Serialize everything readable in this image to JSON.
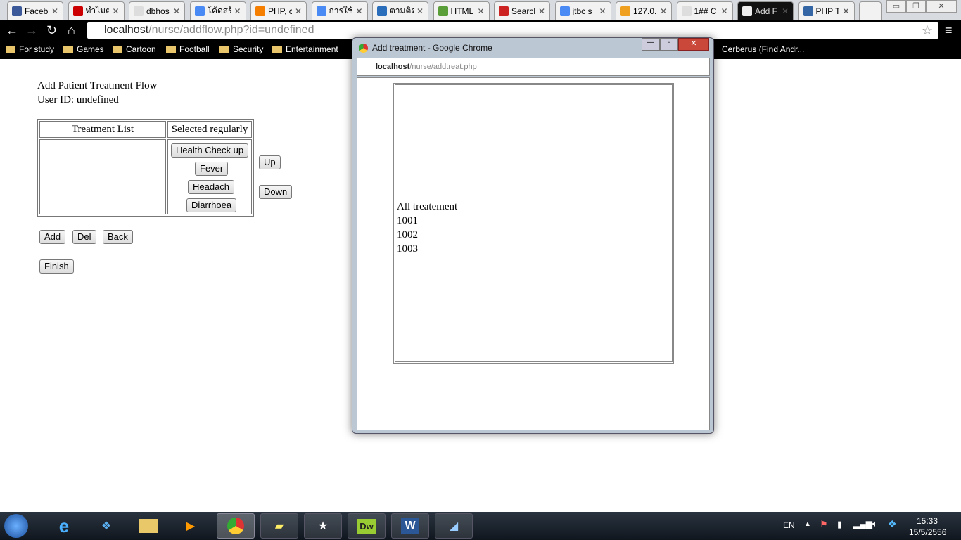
{
  "browser": {
    "tabs": [
      {
        "label": "Faceb",
        "color": "#3b5998"
      },
      {
        "label": "ทำไมต่",
        "color": "#c00"
      },
      {
        "label": "dbhos",
        "color": "#ddd"
      },
      {
        "label": "โค้ดสร้",
        "color": "#4a8af4"
      },
      {
        "label": "PHP, c",
        "color": "#f57d00"
      },
      {
        "label": "การใช้",
        "color": "#4a8af4"
      },
      {
        "label": "ตามติด",
        "color": "#2a6ebb"
      },
      {
        "label": "HTML",
        "color": "#5a9e3a"
      },
      {
        "label": "Search",
        "color": "#c22"
      },
      {
        "label": "jtbc s",
        "color": "#4a8af4"
      },
      {
        "label": "127.0.",
        "color": "#f0a020"
      },
      {
        "label": "1## C",
        "color": "#ddd"
      },
      {
        "label": "Add F",
        "color": "#eee"
      },
      {
        "label": "PHP T",
        "color": "#3465a4"
      }
    ],
    "url_host": "localhost",
    "url_path": "/nurse/addflow.php?id=undefined",
    "bookmarks": [
      "For study",
      "Games",
      "Cartoon",
      "Football",
      "Security",
      "Entertainment"
    ],
    "bookmark_extra": "Cerberus (Find Andr..."
  },
  "page": {
    "heading": "Add Patient Treatment Flow",
    "user_line": "User ID: undefined",
    "col1": "Treatment List",
    "col2": "Selected regularly",
    "selected": [
      "Health Check up",
      "Fever",
      "Headach",
      "Diarrhoea"
    ],
    "up": "Up",
    "down": "Down",
    "add": "Add",
    "del": "Del",
    "back": "Back",
    "finish": "Finish"
  },
  "popup": {
    "title": "Add treatment - Google Chrome",
    "url_host": "localhost",
    "url_path": "/nurse/addtreat.php",
    "list_title": "All treatement",
    "items": [
      "1001",
      "1002",
      "1003"
    ]
  },
  "taskbar": {
    "lang": "EN",
    "time": "15:33",
    "date": "15/5/2556"
  }
}
